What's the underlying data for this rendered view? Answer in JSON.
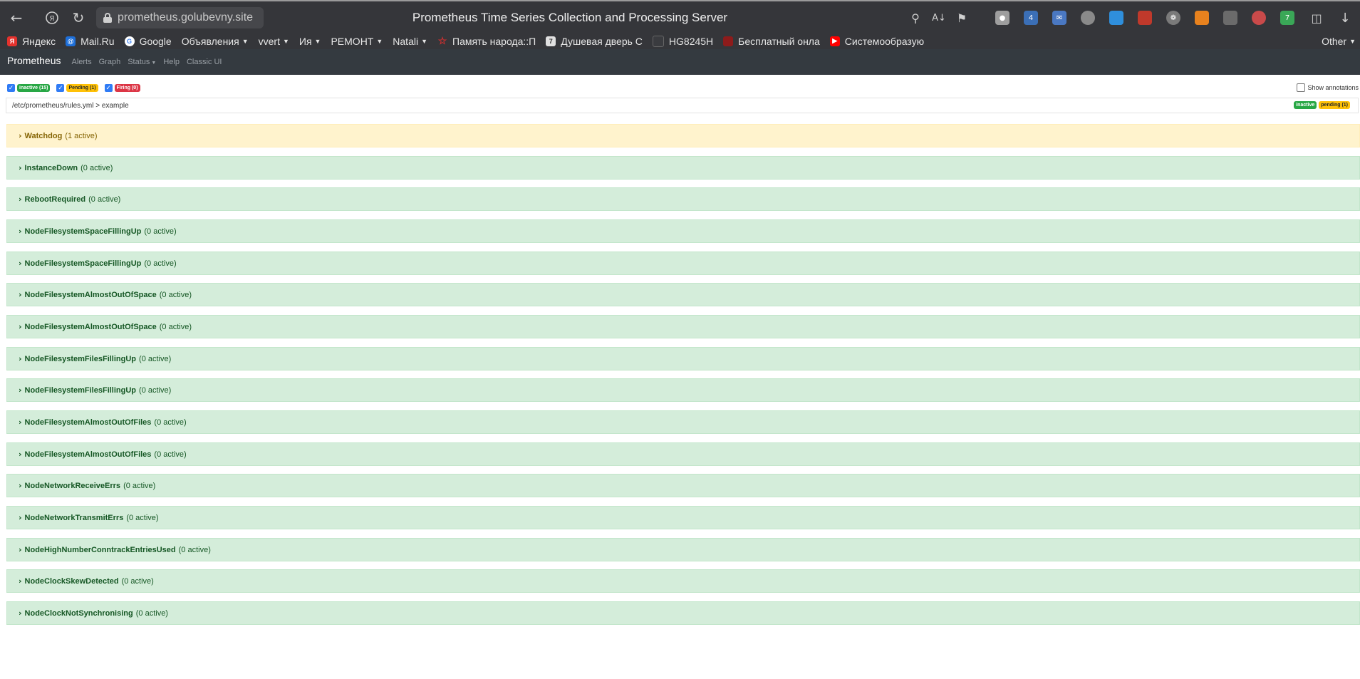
{
  "browser": {
    "url": "prometheus.golubevny.site",
    "page_title": "Prometheus Time Series Collection and Processing Server",
    "extension_badges": {
      "ext_4": "4",
      "ext_7": "7"
    }
  },
  "bookmarks": [
    {
      "label": "Яндекс",
      "icon": "yandex-icon",
      "color": "#e5322d",
      "dropdown": false
    },
    {
      "label": "Mail.Ru",
      "icon": "mailru-icon",
      "color": "#1e6fd9",
      "dropdown": false
    },
    {
      "label": "Google",
      "icon": "google-icon",
      "color": "#ffffff",
      "dropdown": false
    },
    {
      "label": "Объявления",
      "icon": "",
      "color": "",
      "dropdown": true
    },
    {
      "label": "vvert",
      "icon": "",
      "color": "",
      "dropdown": true
    },
    {
      "label": "Ия",
      "icon": "",
      "color": "",
      "dropdown": true
    },
    {
      "label": "РЕМОНТ",
      "icon": "",
      "color": "",
      "dropdown": true
    },
    {
      "label": "Natali",
      "icon": "",
      "color": "",
      "dropdown": true
    },
    {
      "label": "Память народа::П",
      "icon": "star-icon",
      "color": "#c62828",
      "dropdown": false
    },
    {
      "label": "Душевая дверь С",
      "icon": "doc-icon",
      "color": "#e0e0e0",
      "dropdown": false
    },
    {
      "label": "HG8245H",
      "icon": "page-icon",
      "color": "#3a3b3f",
      "dropdown": false
    },
    {
      "label": "Бесплатный онла",
      "icon": "book-icon",
      "color": "#8e1b1b",
      "dropdown": false
    },
    {
      "label": "Системообразую",
      "icon": "youtube-icon",
      "color": "#ff0000",
      "dropdown": false
    }
  ],
  "bookmarks_other": "Other",
  "navbar": {
    "brand": "Prometheus",
    "links": [
      "Alerts",
      "Graph",
      "Status",
      "Help",
      "Classic UI"
    ]
  },
  "filters": {
    "inactive": "inactive (15)",
    "pending": "Pending (1)",
    "firing": "Firing (0)",
    "show_annotations": "Show annotations"
  },
  "group": {
    "path": "/etc/prometheus/rules.yml > example",
    "badge_inactive": "inactive",
    "badge_pending": "pending (1)"
  },
  "rules": [
    {
      "name": "Watchdog",
      "count": "(1 active)",
      "state": "pending"
    },
    {
      "name": "InstanceDown",
      "count": "(0 active)",
      "state": "inactive"
    },
    {
      "name": "RebootRequired",
      "count": "(0 active)",
      "state": "inactive"
    },
    {
      "name": "NodeFilesystemSpaceFillingUp",
      "count": "(0 active)",
      "state": "inactive"
    },
    {
      "name": "NodeFilesystemSpaceFillingUp",
      "count": "(0 active)",
      "state": "inactive"
    },
    {
      "name": "NodeFilesystemAlmostOutOfSpace",
      "count": "(0 active)",
      "state": "inactive"
    },
    {
      "name": "NodeFilesystemAlmostOutOfSpace",
      "count": "(0 active)",
      "state": "inactive"
    },
    {
      "name": "NodeFilesystemFilesFillingUp",
      "count": "(0 active)",
      "state": "inactive"
    },
    {
      "name": "NodeFilesystemFilesFillingUp",
      "count": "(0 active)",
      "state": "inactive"
    },
    {
      "name": "NodeFilesystemAlmostOutOfFiles",
      "count": "(0 active)",
      "state": "inactive"
    },
    {
      "name": "NodeFilesystemAlmostOutOfFiles",
      "count": "(0 active)",
      "state": "inactive"
    },
    {
      "name": "NodeNetworkReceiveErrs",
      "count": "(0 active)",
      "state": "inactive"
    },
    {
      "name": "NodeNetworkTransmitErrs",
      "count": "(0 active)",
      "state": "inactive"
    },
    {
      "name": "NodeHighNumberConntrackEntriesUsed",
      "count": "(0 active)",
      "state": "inactive"
    },
    {
      "name": "NodeClockSkewDetected",
      "count": "(0 active)",
      "state": "inactive"
    },
    {
      "name": "NodeClockNotSynchronising",
      "count": "(0 active)",
      "state": "inactive"
    }
  ],
  "colors": {
    "inactive_bg": "#d4edda",
    "pending_bg": "#fff3cd",
    "navbar_bg": "#343a40",
    "browser_chrome": "#35363a"
  }
}
